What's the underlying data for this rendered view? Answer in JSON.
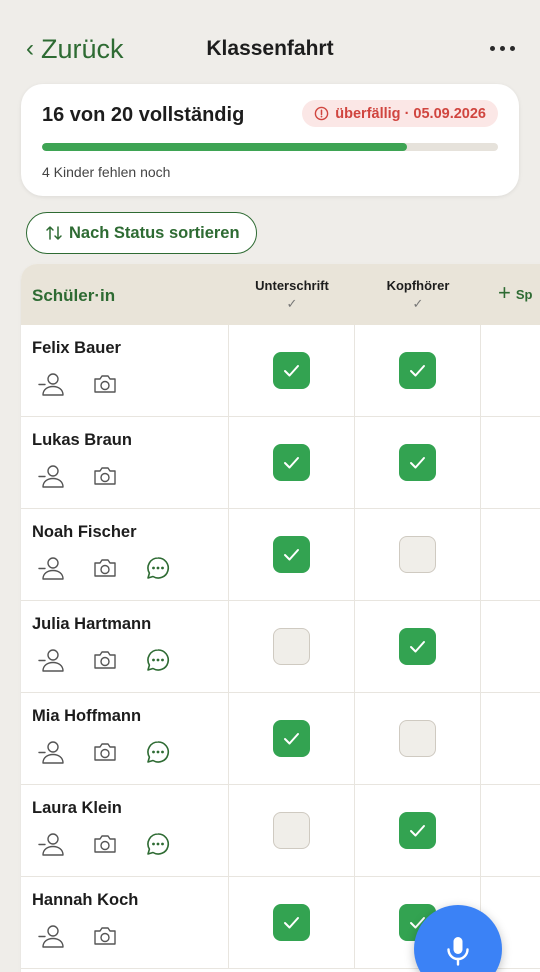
{
  "header": {
    "back_label": "Zurück",
    "title": "Klassenfahrt"
  },
  "summary": {
    "title": "16 von 20 vollständig",
    "badge": "überfällig · 05.09.2026",
    "progress": 0.8,
    "subtitle": "4 Kinder fehlen noch"
  },
  "sort_label": "Nach Status sortieren",
  "table": {
    "name_header": "Schüler·in",
    "columns": [
      {
        "label": "Unterschrift",
        "tick": "✓"
      },
      {
        "label": "Kopfhörer",
        "tick": "✓"
      }
    ],
    "add_label": "Sp",
    "rows": [
      {
        "name": "Felix Bauer",
        "chat": false,
        "values": [
          true,
          true
        ]
      },
      {
        "name": "Lukas Braun",
        "chat": false,
        "values": [
          true,
          true
        ]
      },
      {
        "name": "Noah Fischer",
        "chat": true,
        "values": [
          true,
          false
        ]
      },
      {
        "name": "Julia Hartmann",
        "chat": true,
        "values": [
          false,
          true
        ]
      },
      {
        "name": "Mia Hoffmann",
        "chat": true,
        "values": [
          true,
          false
        ]
      },
      {
        "name": "Laura Klein",
        "chat": true,
        "values": [
          false,
          true
        ]
      },
      {
        "name": "Hannah Koch",
        "chat": false,
        "values": [
          true,
          true
        ]
      }
    ]
  },
  "icons": {
    "back": "chevron-left-icon",
    "more": "more-horizontal-icon",
    "alert": "alert-circle-icon",
    "sort": "sort-arrows-icon",
    "person": "person-icon",
    "camera": "camera-icon",
    "chat": "chat-bubble-icon",
    "mic": "microphone-icon"
  },
  "colors": {
    "accent": "#2e6b33",
    "check": "#33a351",
    "progress": "#3ea454",
    "overdue": "#d0453f",
    "overdue_bg": "#fbe7e6",
    "mic": "#3b82f6"
  }
}
